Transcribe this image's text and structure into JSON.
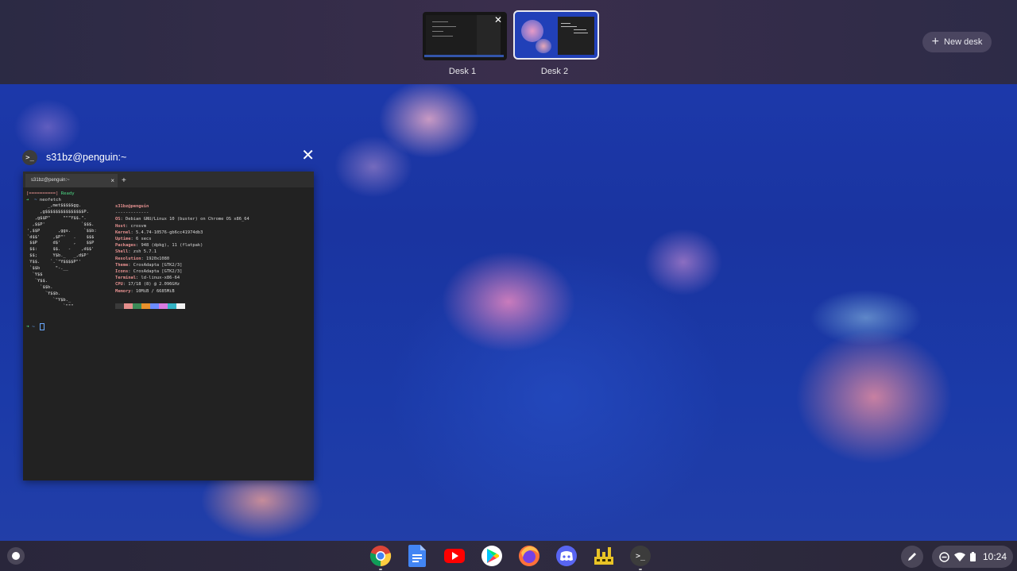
{
  "desks": {
    "items": [
      {
        "label": "Desk 1",
        "close_glyph": "✕"
      },
      {
        "label": "Desk 2"
      }
    ],
    "new_desk_label": "New desk"
  },
  "window": {
    "icon_glyph": ">_",
    "title": "s31bz@penguin:~",
    "close_glyph": "✕"
  },
  "terminal": {
    "tab_label": "s31bz@penguin:~",
    "tab_close": "×",
    "tab_add": "+",
    "ready_bracket": "[==========]",
    "ready_text": "Ready",
    "prompt_arrow": "➜",
    "prompt_dir": "~",
    "command": "neofetch",
    "ascii_art": "        _,met$$$$$gg.\n     ,g$$$$$$$$$$$$$$$P.\n   ,g$$P\"     \"\"\"Y$$.\".\n  ,$$P'              `$$$.\n',$$P       ,ggs.     `$$b:\n`d$$'     ,$P\"'   .    $$$\n $$P      d$'     ,    $$P\n $$:      $$.   -    ,d$$'\n $$;      Y$b._   _,d$P'\n Y$$.    `.`\"Y$$$$P\"'\n `$$b      \"-.__\n  `Y$$\n   `Y$$.\n     `$$b.\n       `Y$$b.\n          `\"Y$b._\n              `\"\"\"",
    "info": {
      "user_host": "s31bz@penguin",
      "separator": "-------------",
      "rows": [
        {
          "key": "OS",
          "value": "Debian GNU/Linux 10 (buster) on Chrome OS x86_64"
        },
        {
          "key": "Host",
          "value": "crosvm"
        },
        {
          "key": "Kernel",
          "value": "5.4.74-10576-gb6cc41974db3"
        },
        {
          "key": "Uptime",
          "value": "6 secs"
        },
        {
          "key": "Packages",
          "value": "948 (dpkg), 11 (flatpak)"
        },
        {
          "key": "Shell",
          "value": "zsh 5.7.1"
        },
        {
          "key": "Resolution",
          "value": "1920x1080"
        },
        {
          "key": "Theme",
          "value": "CrosAdapta [GTK2/3]"
        },
        {
          "key": "Icons",
          "value": "CrosAdapta [GTK2/3]"
        },
        {
          "key": "Terminal",
          "value": "ld-linux-x86-64"
        },
        {
          "key": "CPU",
          "value": "17/18 (8) @ 2.096GHz"
        },
        {
          "key": "Memory",
          "value": "10MiB / 6685MiB"
        }
      ]
    },
    "swatch_colors": [
      "#3a3a3a",
      "#e58f8c",
      "#3c8a57",
      "#e8912c",
      "#6c8cff",
      "#d77be0",
      "#33b3c4",
      "#f2f2f2"
    ],
    "prompt2_arrow": "➜",
    "prompt2_dir": "~"
  },
  "shelf": {
    "apps": [
      {
        "name": "Chrome"
      },
      {
        "name": "Docs"
      },
      {
        "name": "YouTube"
      },
      {
        "name": "Play Store"
      },
      {
        "name": "Firefox"
      },
      {
        "name": "Discord"
      },
      {
        "name": "Factorio"
      },
      {
        "name": "Terminal",
        "glyph": ">_"
      }
    ],
    "clock": "10:24"
  },
  "colors": {
    "accent_green": "#4ddb86",
    "label_pink": "#e59190",
    "shelf_bg": "#2f2b40"
  }
}
